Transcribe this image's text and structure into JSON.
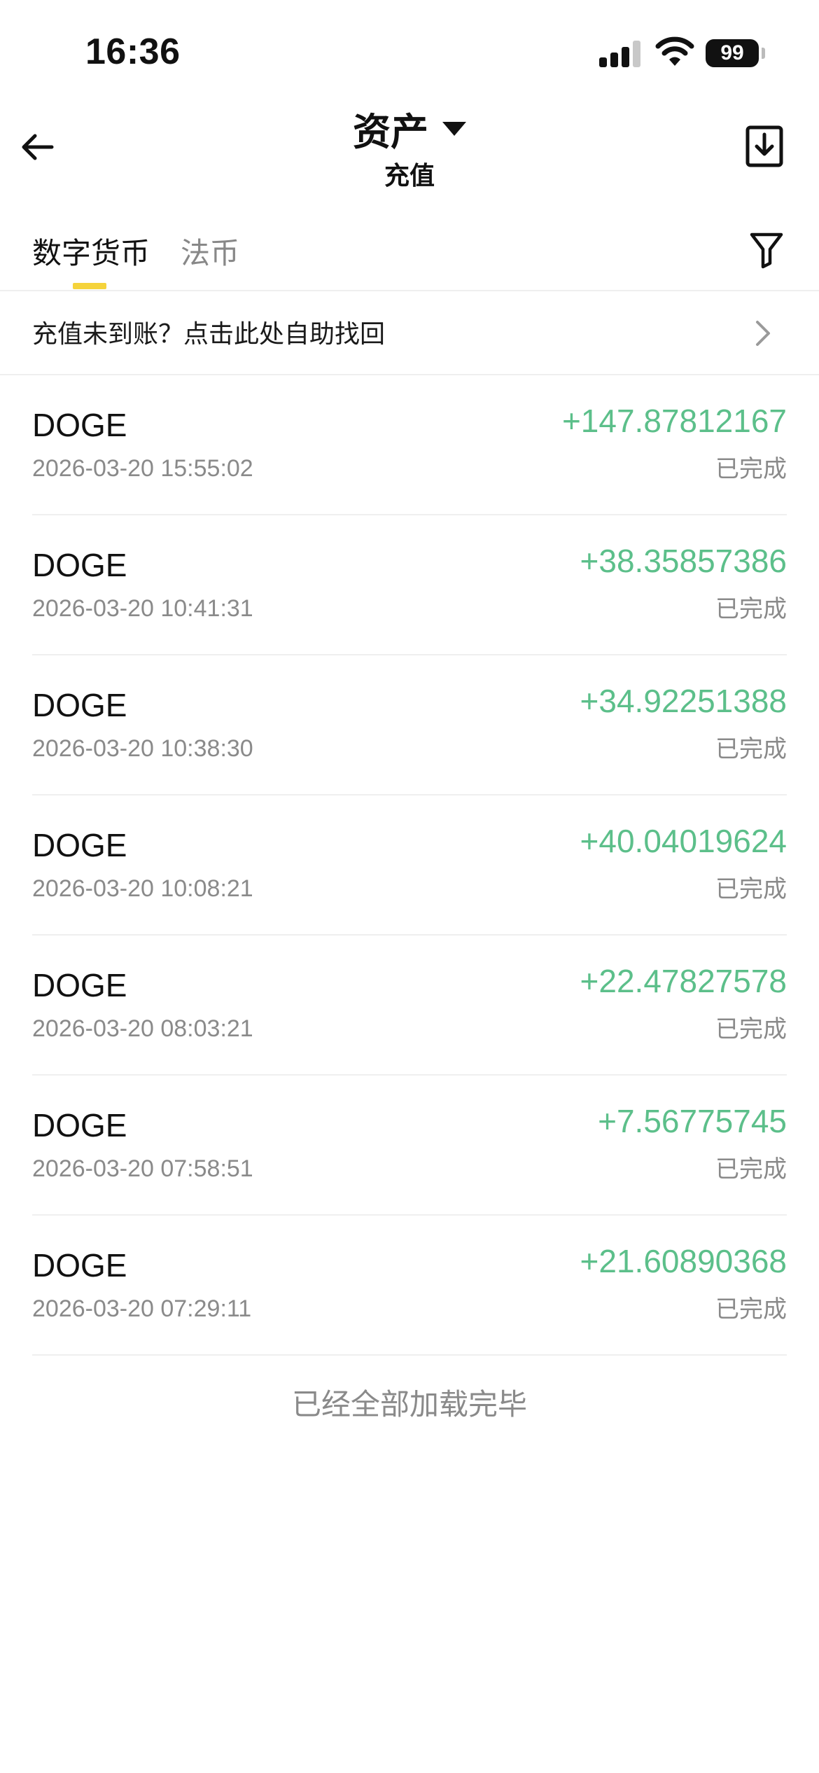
{
  "status_bar": {
    "time": "16:36",
    "battery": "99"
  },
  "header": {
    "title": "资产",
    "subtitle": "充值",
    "back_icon": "arrow-left-icon",
    "export_icon": "download-export-icon"
  },
  "tabs": [
    {
      "label": "数字货币",
      "active": true
    },
    {
      "label": "法币",
      "active": false
    }
  ],
  "notice": {
    "text": "充值未到账？点击此处自助找回"
  },
  "transactions": [
    {
      "coin": "DOGE",
      "date": "2026-03-20 15:55:02",
      "amount": "+147.87812167",
      "status": "已完成"
    },
    {
      "coin": "DOGE",
      "date": "2026-03-20 10:41:31",
      "amount": "+38.35857386",
      "status": "已完成"
    },
    {
      "coin": "DOGE",
      "date": "2026-03-20 10:38:30",
      "amount": "+34.92251388",
      "status": "已完成"
    },
    {
      "coin": "DOGE",
      "date": "2026-03-20 10:08:21",
      "amount": "+40.04019624",
      "status": "已完成"
    },
    {
      "coin": "DOGE",
      "date": "2026-03-20 08:03:21",
      "amount": "+22.47827578",
      "status": "已完成"
    },
    {
      "coin": "DOGE",
      "date": "2026-03-20 07:58:51",
      "amount": "+7.56775745",
      "status": "已完成"
    },
    {
      "coin": "DOGE",
      "date": "2026-03-20 07:29:11",
      "amount": "+21.60890368",
      "status": "已完成"
    }
  ],
  "footer": {
    "end_text": "已经全部加载完毕"
  },
  "colors": {
    "accent_underline": "#f5d33b",
    "amount_positive": "#5cbf8a",
    "secondary_text": "#8a8a8a"
  }
}
